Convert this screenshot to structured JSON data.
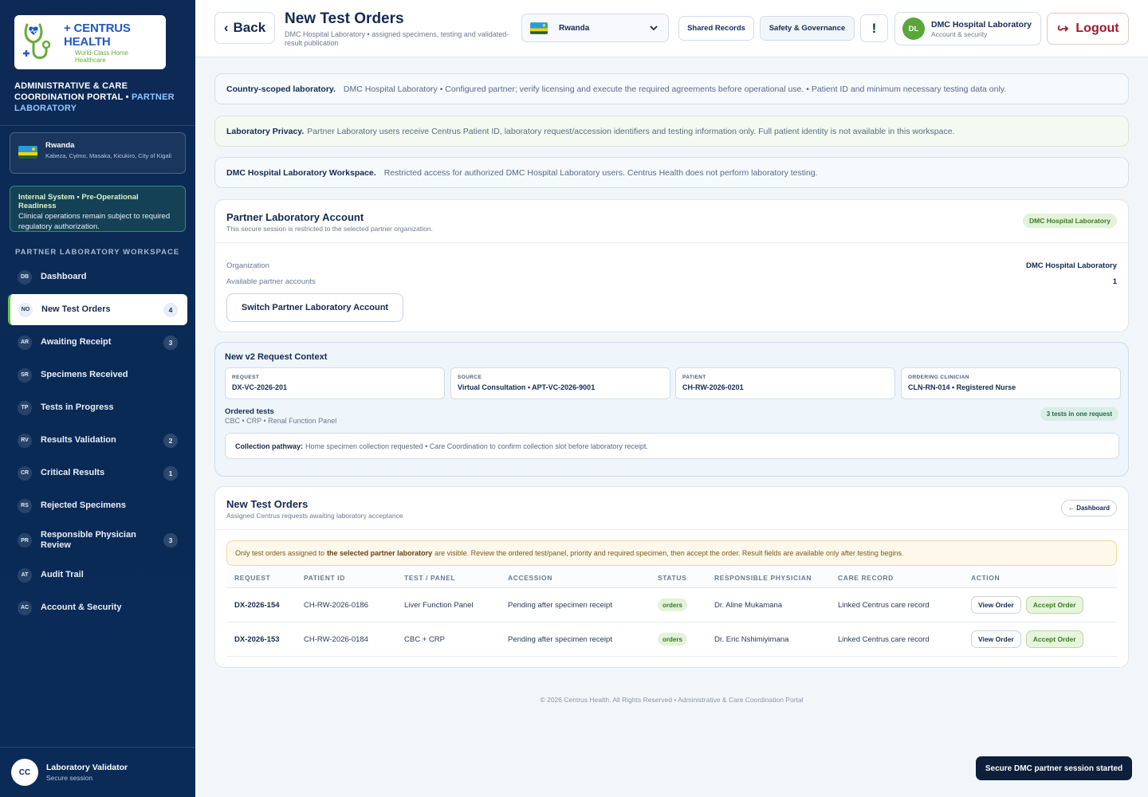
{
  "brand": {
    "logo_name": "CENTRUS HEALTH",
    "logo_tagline": "World-Class Home Healthcare",
    "portal_title": "ADMINISTRATIVE & CARE COORDINATION PORTAL",
    "portal_role": "PARTNER LABORATORY"
  },
  "sidebar": {
    "country": {
      "name": "Rwanda",
      "districts": "Kabeza, Cyimo, Masaka, Kicukiro, City of Kigali"
    },
    "readiness": {
      "title": "Internal System • Pre-Operational Readiness",
      "body": "Clinical operations remain subject to required regulatory authorization."
    },
    "workspace_label": "PARTNER LABORATORY WORKSPACE",
    "items": [
      {
        "abbr": "DB",
        "label": "Dashboard",
        "count": ""
      },
      {
        "abbr": "NO",
        "label": "New Test Orders",
        "count": "4"
      },
      {
        "abbr": "AR",
        "label": "Awaiting Receipt",
        "count": "3"
      },
      {
        "abbr": "SR",
        "label": "Specimens Received",
        "count": ""
      },
      {
        "abbr": "TP",
        "label": "Tests in Progress",
        "count": ""
      },
      {
        "abbr": "RV",
        "label": "Results Validation",
        "count": "2"
      },
      {
        "abbr": "CR",
        "label": "Critical Results",
        "count": "1"
      },
      {
        "abbr": "RS",
        "label": "Rejected Specimens",
        "count": ""
      },
      {
        "abbr": "PR",
        "label": "Responsible Physician Review",
        "count": "3"
      },
      {
        "abbr": "AT",
        "label": "Audit Trail",
        "count": ""
      },
      {
        "abbr": "AC",
        "label": "Account & Security",
        "count": ""
      }
    ],
    "user": {
      "initials": "CC",
      "name": "Laboratory Validator",
      "status": "Secure session"
    }
  },
  "header": {
    "back_label": "Back",
    "title": "New Test Orders",
    "subtitle": "DMC Hospital Laboratory • assigned specimens, testing and validated-result publication",
    "country_select": "Rwanda",
    "shared_records": "Shared Records",
    "safety": "Safety & Governance",
    "alert": "!",
    "account": {
      "initials": "DL",
      "name": "DMC Hospital Laboratory",
      "sub": "Account & security"
    },
    "logout": "Logout"
  },
  "notices": {
    "scope_title": "Country-scoped laboratory.",
    "scope_body": "DMC Hospital Laboratory • Configured partner; verify licensing and execute the required agreements before operational use. • Patient ID and minimum necessary testing data only.",
    "privacy_title": "Laboratory Privacy.",
    "privacy_body": "Partner Laboratory users receive Centrus Patient ID, laboratory request/accession identifiers and testing information only. Full patient identity is not available in this workspace.",
    "workspace_title": "DMC Hospital Laboratory Workspace.",
    "workspace_body": "Restricted access for authorized DMC Hospital Laboratory users. Centrus Health does not perform laboratory testing."
  },
  "account_card": {
    "title": "Partner Laboratory Account",
    "subtitle": "This secure session is restricted to the selected partner organization.",
    "tag": "DMC Hospital Laboratory",
    "org_label": "Organization",
    "org_value": "DMC Hospital Laboratory",
    "avail_label": "Available partner accounts",
    "avail_value": "1",
    "switch_label": "Switch Partner Laboratory Account"
  },
  "context": {
    "title": "New v2 Request Context",
    "boxes": [
      {
        "key": "REQUEST",
        "value": "DX-VC-2026-201"
      },
      {
        "key": "SOURCE",
        "value": "Virtual Consultation • APT-VC-2026-9001"
      },
      {
        "key": "PATIENT",
        "value": "CH-RW-2026-0201"
      },
      {
        "key": "ORDERING CLINICIAN",
        "value": "CLN-RN-014 • Registered Nurse"
      }
    ],
    "ordered_label": "Ordered tests",
    "ordered_value": "CBC • CRP • Renal Function Panel",
    "tests_tag": "3 tests in one request",
    "pathway_label": "Collection pathway:",
    "pathway_value": "Home specimen collection requested • Care Coordination to confirm collection slot before laboratory receipt."
  },
  "orders": {
    "title": "New Test Orders",
    "subtitle": "Assigned Centrus requests awaiting laboratory acceptance",
    "dashboard_btn": "← Dashboard",
    "warn_pre": "Only test orders assigned to",
    "warn_bold": "the selected partner laboratory",
    "warn_post": "are visible. Review the ordered test/panel, priority and required specimen, then accept the order. Result fields are available only after testing begins.",
    "columns": [
      "REQUEST",
      "PATIENT ID",
      "TEST / PANEL",
      "ACCESSION",
      "STATUS",
      "RESPONSIBLE PHYSICIAN",
      "CARE RECORD",
      "ACTION"
    ],
    "rows": [
      {
        "request": "DX-2026-154",
        "patient": "CH-RW-2026-0186",
        "test": "Liver Function Panel",
        "accession": "Pending after specimen receipt",
        "status": "orders",
        "physician": "Dr. Aline Mukamana",
        "record": "Linked Centrus care record",
        "view": "View Order",
        "accept": "Accept Order"
      },
      {
        "request": "DX-2026-153",
        "patient": "CH-RW-2026-0184",
        "test": "CBC + CRP",
        "accession": "Pending after specimen receipt",
        "status": "orders",
        "physician": "Dr. Eric Nshimiyimana",
        "record": "Linked Centrus care record",
        "view": "View Order",
        "accept": "Accept Order"
      }
    ]
  },
  "footer": "© 2026 Centrus Health. All Rights Reserved • Administrative & Care Coordination Portal",
  "toast": "Secure DMC partner session started",
  "colors": {
    "navy": "#0c2a55",
    "accent_green": "#6ac04a",
    "logout_red": "#a3192a"
  }
}
